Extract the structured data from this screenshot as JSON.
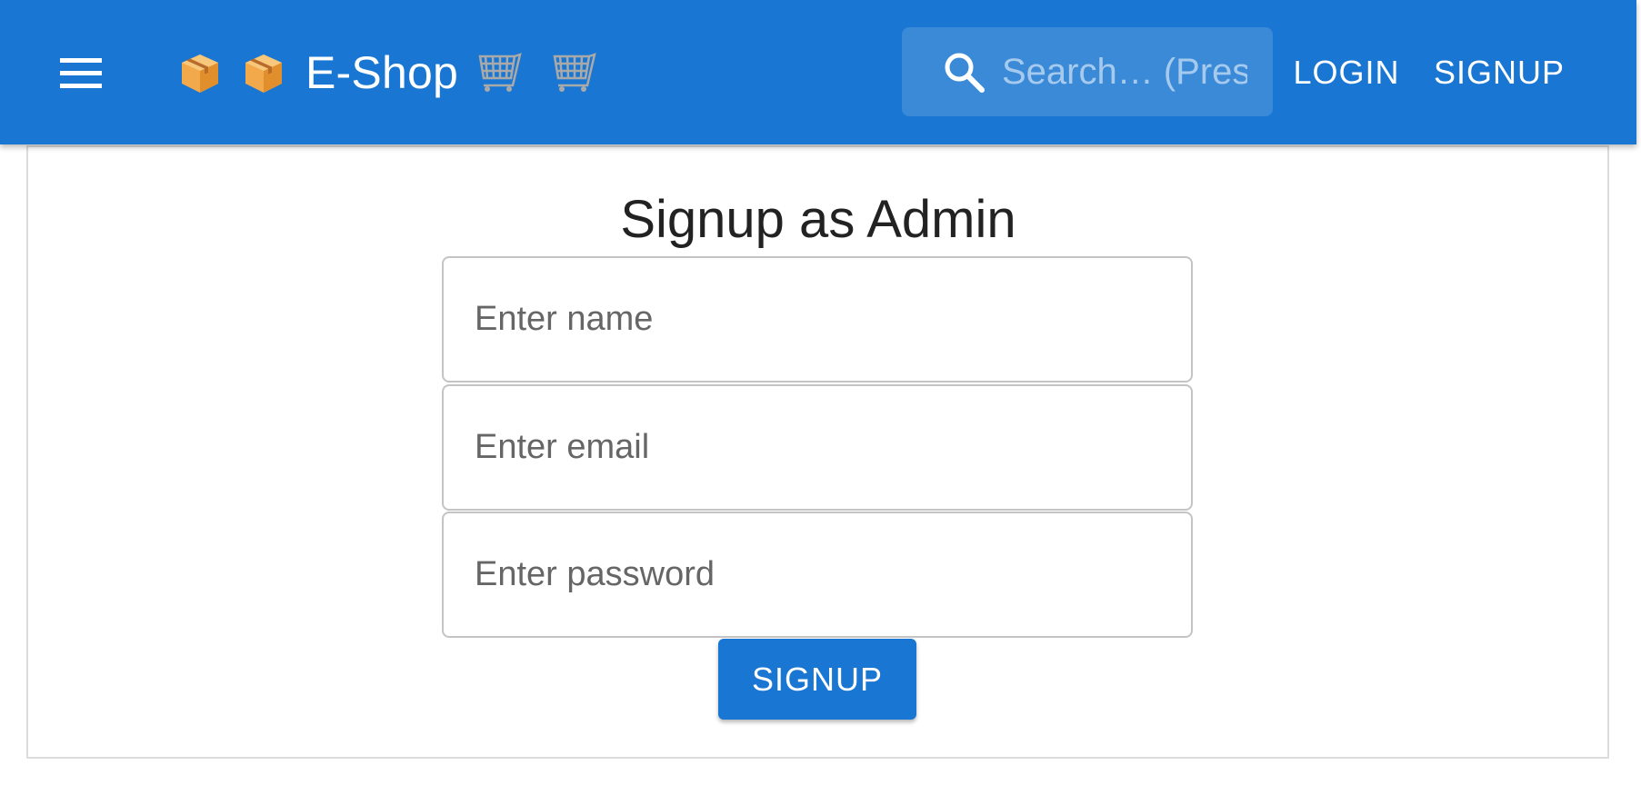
{
  "header": {
    "title": "E-Shop",
    "menu_icon": "hamburger-menu-icon",
    "brand_icons": [
      "package-icon",
      "package-icon"
    ],
    "cart_icons": [
      "shopping-cart-icon",
      "shopping-cart-icon"
    ],
    "search": {
      "placeholder": "Search… (Press",
      "icon": "search-icon"
    },
    "login_label": "LOGIN",
    "signup_label": "SIGNUP",
    "bar_color": "#1976d2"
  },
  "form": {
    "title": "Signup as Admin",
    "name_placeholder": "Enter name",
    "email_placeholder": "Enter email",
    "password_placeholder": "Enter password",
    "submit_label": "SIGNUP"
  }
}
